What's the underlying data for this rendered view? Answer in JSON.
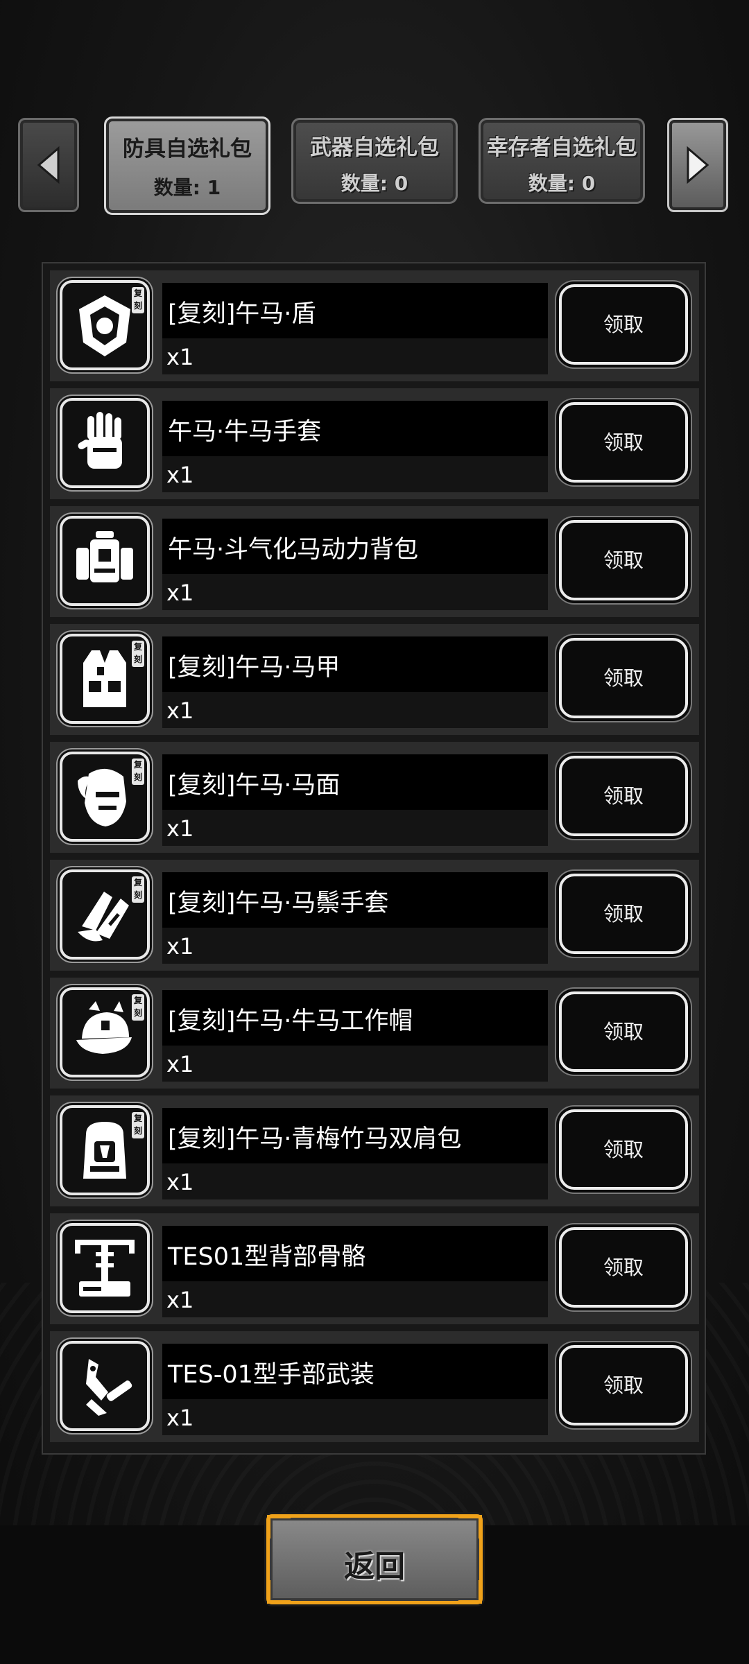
{
  "tabs": {
    "left_arrow": "chevron-left-icon",
    "right_arrow": "chevron-right-icon",
    "items": [
      {
        "title": "防具自选礼包",
        "count": "数量: 1",
        "active": true
      },
      {
        "title": "武器自选礼包",
        "count": "数量: 0",
        "active": false
      },
      {
        "title": "幸存者自选礼包",
        "count": "数量: 0",
        "active": false
      }
    ]
  },
  "list": {
    "claim_label": "领取",
    "badge_label": "复刻",
    "items": [
      {
        "name": "[复刻]午马·盾",
        "qty": "x1",
        "icon": "shield-icon",
        "badge": true
      },
      {
        "name": "午马·牛马手套",
        "qty": "x1",
        "icon": "glove-icon",
        "badge": false
      },
      {
        "name": "午马·斗气化马动力背包",
        "qty": "x1",
        "icon": "power-backpack-icon",
        "badge": false
      },
      {
        "name": "[复刻]午马·马甲",
        "qty": "x1",
        "icon": "vest-icon",
        "badge": true
      },
      {
        "name": "[复刻]午马·马面",
        "qty": "x1",
        "icon": "horse-mask-icon",
        "badge": true
      },
      {
        "name": "[复刻]午马·马鬃手套",
        "qty": "x1",
        "icon": "mane-glove-icon",
        "badge": true
      },
      {
        "name": "[复刻]午马·牛马工作帽",
        "qty": "x1",
        "icon": "work-cap-icon",
        "badge": true
      },
      {
        "name": "[复刻]午马·青梅竹马双肩包",
        "qty": "x1",
        "icon": "backpack-icon",
        "badge": true
      },
      {
        "name": "TES01型背部骨骼",
        "qty": "x1",
        "icon": "back-exoskeleton-icon",
        "badge": false
      },
      {
        "name": "TES-01型手部武装",
        "qty": "x1",
        "icon": "arm-weapon-icon",
        "badge": false
      }
    ]
  },
  "footer": {
    "back_label": "返回"
  },
  "colors": {
    "accent": "#f0a21a",
    "active_tab": "#8a8a8a"
  }
}
